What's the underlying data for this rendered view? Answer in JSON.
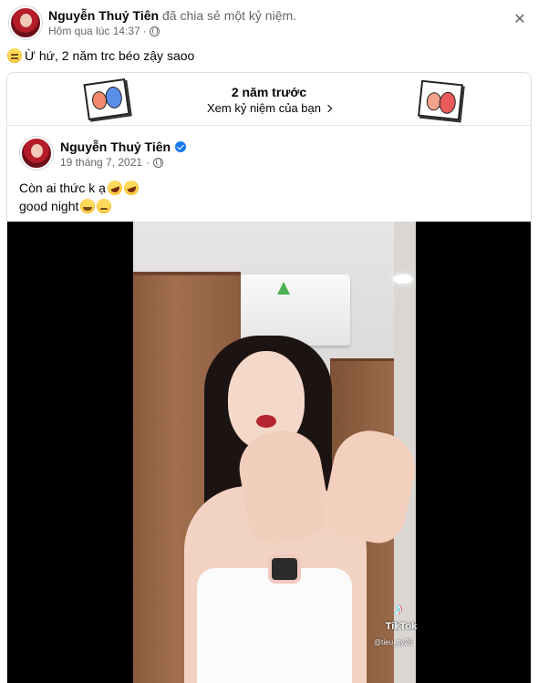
{
  "post": {
    "author": "Nguyễn Thuỷ Tiên",
    "action": "đã chia sẻ một kỷ niệm.",
    "time": "Hôm qua lúc 14:37",
    "privacy_sep": "·",
    "privacy_icon": "globe-icon",
    "close_icon": "close-icon",
    "close_glyph": "✕",
    "text": "Ừ hứ, 2 năm trc béo zậy saoo",
    "text_emoji": "grinning-sweat-emoji"
  },
  "memory": {
    "title": "2 năm trước",
    "link": "Xem kỷ niệm của bạn",
    "chevron_icon": "chevron-right-icon"
  },
  "original_post": {
    "author": "Nguyễn Thuỷ Tiên",
    "verified_icon": "verified-badge-icon",
    "date": "19 tháng 7, 2021",
    "privacy_sep": "·",
    "privacy_icon": "globe-icon",
    "line1": "Còn ai thức k ạ",
    "line1_emojis": [
      "rolling-laughing-emoji",
      "rolling-laughing-emoji"
    ],
    "line2": "good night",
    "line2_emojis": [
      "smiling-emoji",
      "shy-emoji"
    ]
  },
  "video": {
    "watermark": "TikTok",
    "handle": "@tieu_tly26",
    "tiktok_icon": "tiktok-logo-icon"
  }
}
